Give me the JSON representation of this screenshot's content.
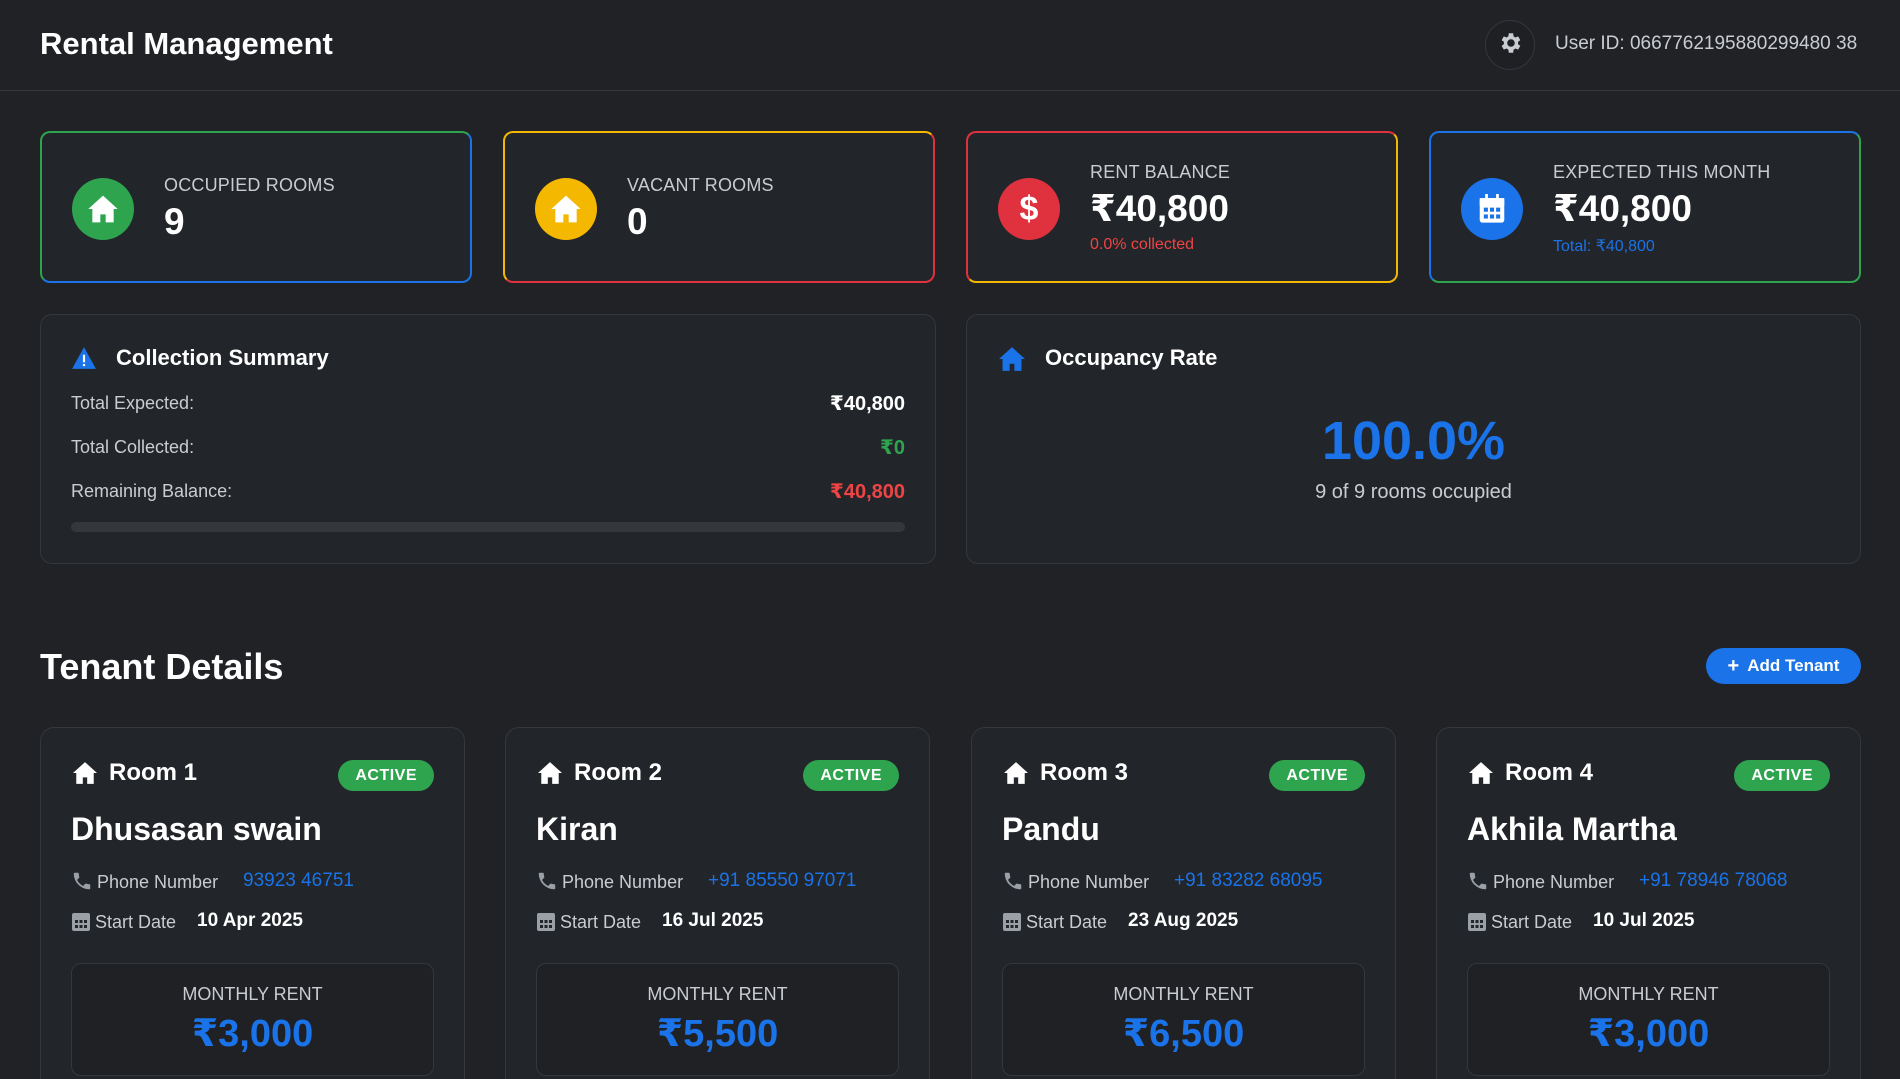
{
  "header": {
    "title": "Rental Management",
    "settings_icon": "gear-icon",
    "user_id": "User ID: 0667762195880299480 38"
  },
  "stats": [
    {
      "label": "OCCUPIED ROOMS",
      "value": "9",
      "sub": "",
      "icon": "house-icon",
      "color": "#2ea44f"
    },
    {
      "label": "VACANT ROOMS",
      "value": "0",
      "sub": "",
      "icon": "house-icon",
      "color": "#f5b800"
    },
    {
      "label": "RENT BALANCE",
      "value": "₹40,800",
      "sub": "0.0% collected",
      "icon": "dollar-icon",
      "color": "#e0313e"
    },
    {
      "label": "EXPECTED THIS MONTH",
      "value": "₹40,800",
      "sub": "Total: ₹40,800",
      "icon": "calendar-icon",
      "color": "#1a73e8"
    }
  ],
  "collection": {
    "title": "Collection Summary",
    "icon": "warning-icon",
    "rows": [
      {
        "label": "Total Expected:",
        "value": "₹40,800",
        "color": "#ffffff"
      },
      {
        "label": "Total Collected:",
        "value": "₹0",
        "color": "#2ea44f"
      },
      {
        "label": "Remaining Balance:",
        "value": "₹40,800",
        "color": "#ef4444"
      }
    ],
    "progress": 0
  },
  "occupancy": {
    "title": "Occupancy Rate",
    "icon": "house-icon",
    "value": "100.0%",
    "sub": "9 of 9 rooms occupied"
  },
  "tenants_section": {
    "title": "Tenant Details",
    "add_button": "Add Tenant"
  },
  "tenants": [
    {
      "room": "Room 1",
      "status": "ACTIVE",
      "name": "Dhusasan swain",
      "phone_label": "Phone Number",
      "phone": "93923 46751",
      "date_label": "Start Date",
      "date": "10 Apr 2025",
      "rent_label": "MONTHLY RENT",
      "rent": "₹3,000"
    },
    {
      "room": "Room 2",
      "status": "ACTIVE",
      "name": "Kiran",
      "phone_label": "Phone Number",
      "phone": "+91 85550 97071",
      "date_label": "Start Date",
      "date": "16 Jul 2025",
      "rent_label": "MONTHLY RENT",
      "rent": "₹5,500"
    },
    {
      "room": "Room 3",
      "status": "ACTIVE",
      "name": "Pandu",
      "phone_label": "Phone Number",
      "phone": "+91 83282 68095",
      "date_label": "Start Date",
      "date": "23 Aug 2025",
      "rent_label": "MONTHLY RENT",
      "rent": "₹6,500"
    },
    {
      "room": "Room 4",
      "status": "ACTIVE",
      "name": "Akhila Martha",
      "phone_label": "Phone Number",
      "phone": "+91 78946 78068",
      "date_label": "Start Date",
      "date": "10 Jul 2025",
      "rent_label": "MONTHLY RENT",
      "rent": "₹3,000"
    }
  ]
}
